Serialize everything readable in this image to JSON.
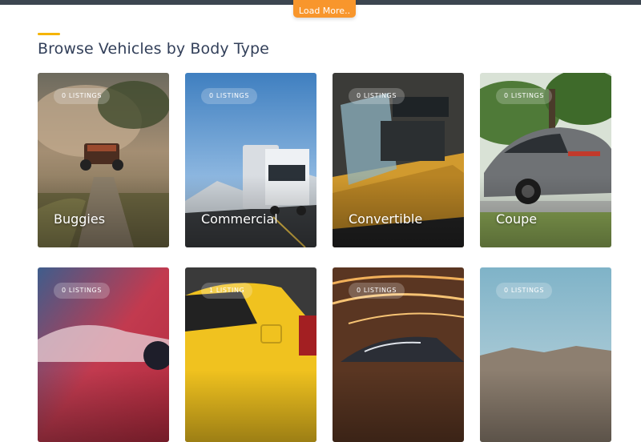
{
  "header": {
    "load_more_label": "Load More.."
  },
  "section": {
    "title": "Browse Vehicles by Body Type"
  },
  "body_types": [
    {
      "name": "Buggies",
      "listings": "0 LISTINGS"
    },
    {
      "name": "Commercial",
      "listings": "0 LISTINGS"
    },
    {
      "name": "Convertible",
      "listings": "0 LISTINGS"
    },
    {
      "name": "Coupe",
      "listings": "0 LISTINGS"
    },
    {
      "name": "",
      "listings": "0 LISTINGS"
    },
    {
      "name": "",
      "listings": "1 LISTING"
    },
    {
      "name": "",
      "listings": "0 LISTINGS"
    },
    {
      "name": "",
      "listings": "0 LISTINGS"
    }
  ],
  "colors": {
    "accent_orange": "#f8962c",
    "accent_yellow": "#f5b400",
    "title_text": "#33405a"
  }
}
